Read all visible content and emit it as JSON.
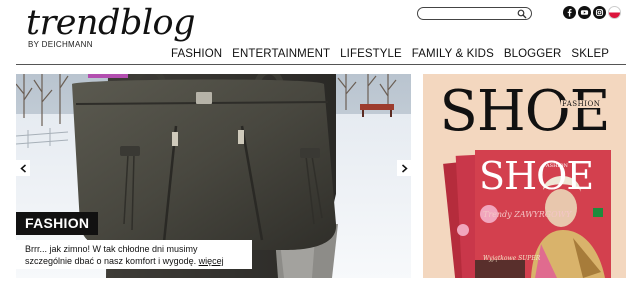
{
  "logo": {
    "main": "trendblog",
    "sub": "BY DEICHMANN"
  },
  "search": {
    "placeholder": ""
  },
  "social": [
    "facebook-icon",
    "youtube-icon",
    "instagram-icon",
    "polish-flag-icon"
  ],
  "nav": {
    "items": [
      "FASHION",
      "ENTERTAINMENT",
      "LIFESTYLE",
      "FAMILY & KIDS",
      "BLOGGER",
      "SKLEP"
    ]
  },
  "slider": {
    "category": "FASHION",
    "caption_line1": "Brrr... jak zimno! W tak chłodne dni musimy",
    "caption_line2": "szczególnie dbać o nasz komfort i wygodę.",
    "more_link": "więcej"
  },
  "ad": {
    "title": "SHOE",
    "title_tag": "FASHION",
    "cover_title": "SHOE",
    "cover_tag": "FASHION",
    "cover_trends": "Trendy ZAWYRGOWY",
    "cover_strip": "Wyjątkowe SUPER"
  },
  "colors": {
    "accent": "#111111",
    "ad_background": "#f3d7bf",
    "cover_pink": "#e05c8a"
  }
}
